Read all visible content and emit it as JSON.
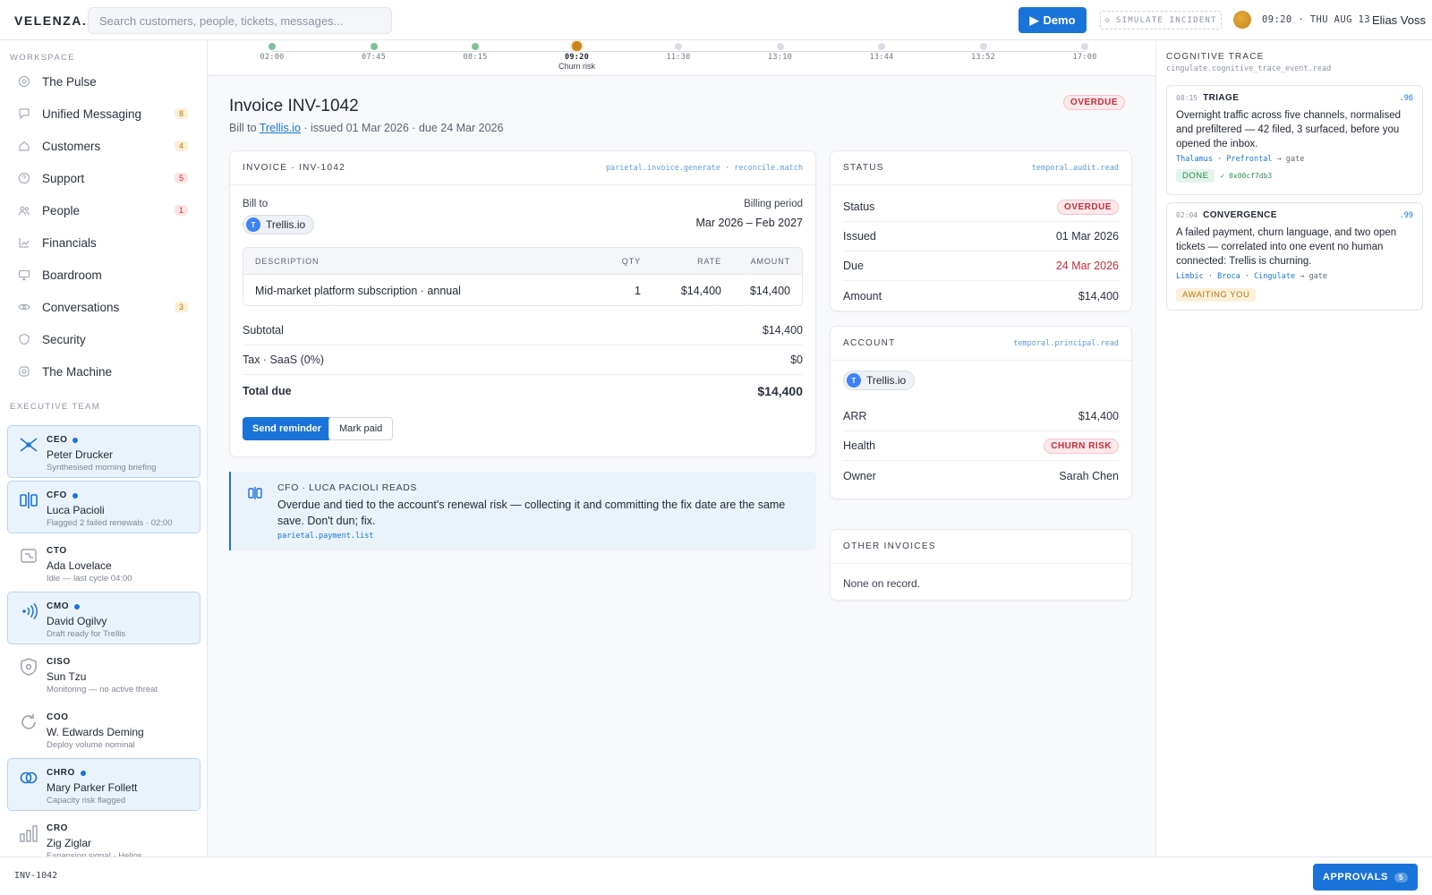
{
  "app": {
    "logo": "VELENZA.",
    "search_placeholder": "Search customers, people, tickets, messages...",
    "demo_label": "Demo",
    "simulate_label": "SIMULATE INCIDENT",
    "clock": "09:20 · THU AUG 13",
    "user": "Elias Voss"
  },
  "sidebar": {
    "workspace_title": "WORKSPACE",
    "items": [
      {
        "label": "The Pulse",
        "icon": "pulse-icon"
      },
      {
        "label": "Unified Messaging",
        "icon": "message-icon",
        "badge": "8",
        "badge_tone": "amber"
      },
      {
        "label": "Customers",
        "icon": "home-icon",
        "badge": "4",
        "badge_tone": "amber"
      },
      {
        "label": "Support",
        "icon": "help-icon",
        "badge": "5",
        "badge_tone": "red"
      },
      {
        "label": "People",
        "icon": "people-icon",
        "badge": "1",
        "badge_tone": "red"
      },
      {
        "label": "Financials",
        "icon": "chart-icon"
      },
      {
        "label": "Boardroom",
        "icon": "monitor-icon"
      },
      {
        "label": "Conversations",
        "icon": "eye-icon",
        "badge": "3",
        "badge_tone": "amber"
      },
      {
        "label": "Security",
        "icon": "shield-icon"
      },
      {
        "label": "The Machine",
        "icon": "gear-icon"
      }
    ],
    "exec_title": "EXECUTIVE TEAM",
    "execs": [
      {
        "role": "CEO",
        "name": "Peter Drucker",
        "sub": "Synthesised morning briefing",
        "live": true
      },
      {
        "role": "CFO",
        "name": "Luca Pacioli",
        "sub": "Flagged 2 failed renewals · 02:00",
        "live": true
      },
      {
        "role": "CTO",
        "name": "Ada Lovelace",
        "sub": "Idle — last cycle 04:00",
        "live": false
      },
      {
        "role": "CMO",
        "name": "David Ogilvy",
        "sub": "Draft ready for Trellis",
        "live": true
      },
      {
        "role": "CISO",
        "name": "Sun Tzu",
        "sub": "Monitoring — no active threat",
        "live": false
      },
      {
        "role": "COO",
        "name": "W. Edwards Deming",
        "sub": "Deploy volume nominal",
        "live": false
      },
      {
        "role": "CHRO",
        "name": "Mary Parker Follett",
        "sub": "Capacity risk flagged",
        "live": true
      },
      {
        "role": "CRO",
        "name": "Zig Ziglar",
        "sub": "Expansion signal · Helios",
        "live": false
      }
    ]
  },
  "timeline": [
    {
      "time": "02:00",
      "state": "done"
    },
    {
      "time": "07:45",
      "state": "done"
    },
    {
      "time": "08:15",
      "state": "done"
    },
    {
      "time": "09:20",
      "state": "now",
      "label": "Churn risk"
    },
    {
      "time": "11:30",
      "state": "future"
    },
    {
      "time": "13:10",
      "state": "future"
    },
    {
      "time": "13:44",
      "state": "future"
    },
    {
      "time": "13:52",
      "state": "future"
    },
    {
      "time": "17:00",
      "state": "future"
    }
  ],
  "invoice": {
    "title": "Invoice INV-1042",
    "meta_prefix": "Bill to",
    "customer": "Trellis.io",
    "meta_suffix": "· issued 01 Mar 2026 · due 24 Mar 2026",
    "status": "OVERDUE",
    "card_title": "INVOICE · INV-1042",
    "card_tag": "parietal.invoice.generate · reconcile.match",
    "bill_to_label": "Bill to",
    "customer_initial": "T",
    "period_label": "Billing period",
    "period": "Mar 2026 – Feb 2027",
    "columns": [
      "DESCRIPTION",
      "QTY",
      "RATE",
      "AMOUNT"
    ],
    "line": {
      "description": "Mid-market platform subscription · annual",
      "qty": "1",
      "rate": "$14,400",
      "amount": "$14,400"
    },
    "subtotal_label": "Subtotal",
    "subtotal": "$14,400",
    "tax_label": "Tax · SaaS (0%)",
    "tax": "$0",
    "total_label": "Total due",
    "total": "$14,400",
    "send_label": "Send reminder",
    "mark_label": "Mark paid"
  },
  "cfo_note": {
    "heading": "CFO · LUCA PACIOLI READS",
    "body": "Overdue and tied to the account's renewal risk — collecting it and committing the fix date are the same save. Don't dun; fix.",
    "tag": "parietal.payment.list"
  },
  "status_card": {
    "title": "STATUS",
    "tag": "temporal.audit.read",
    "rows": [
      {
        "label": "Status",
        "value": "OVERDUE"
      },
      {
        "label": "Issued",
        "value": "01 Mar 2026"
      },
      {
        "label": "Due",
        "value": "24 Mar 2026"
      },
      {
        "label": "Amount",
        "value": "$14,400"
      }
    ]
  },
  "account_card": {
    "title": "ACCOUNT",
    "tag": "temporal.principal.read",
    "customer": "Trellis.io",
    "initial": "T",
    "rows": [
      {
        "label": "ARR",
        "value": "$14,400"
      },
      {
        "label": "Health",
        "value": "CHURN RISK"
      },
      {
        "label": "Owner",
        "value": "Sarah Chen"
      }
    ]
  },
  "other_card": {
    "title": "OTHER INVOICES",
    "empty": "None on record."
  },
  "trace": {
    "title": "COGNITIVE TRACE",
    "tag": "cingulate.cognitive_trace_event.read",
    "events": [
      {
        "time": "08:15",
        "title": "TRIAGE",
        "score": ".96",
        "body": "Overnight traffic across five channels, normalised and prefiltered — 42 filed, 3 surfaced, before you opened the inbox.",
        "chain": [
          "Thalamus",
          "Prefrontal"
        ],
        "gate": "→ gate",
        "status": "DONE",
        "hash": "✓ 0x00cf7db3"
      },
      {
        "time": "02:04",
        "title": "CONVERGENCE",
        "score": ".99",
        "body": "A failed payment, churn language, and two open tickets — correlated into one event no human connected: Trellis is churning.",
        "chain": [
          "Limbic",
          "Broca",
          "Cingulate"
        ],
        "gate": "→ gate",
        "status": "AWAITING YOU"
      }
    ]
  },
  "bottom": {
    "crumb": "INV-1042",
    "approvals_label": "APPROVALS",
    "approvals_count": "5"
  },
  "colors": {
    "accent": "#1a73d9",
    "danger": "#c42d3a",
    "warning": "#b77a16",
    "success": "#2d8a52"
  }
}
